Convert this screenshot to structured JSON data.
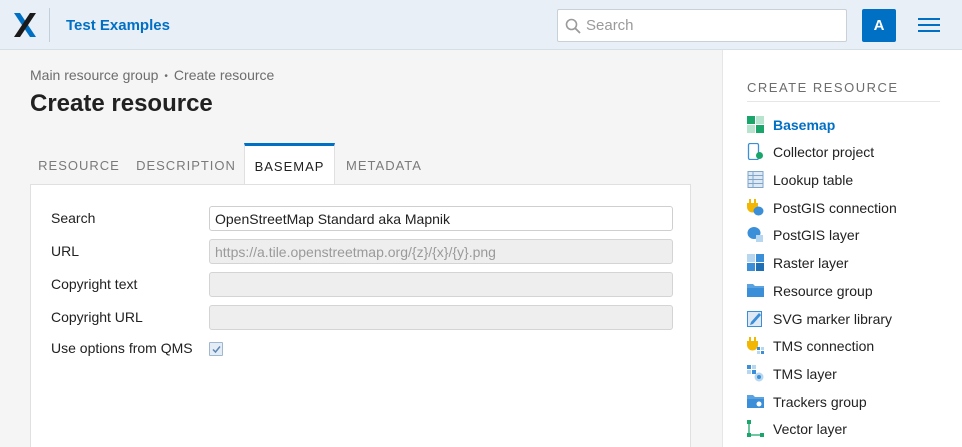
{
  "header": {
    "app_title": "Test Examples",
    "search_placeholder": "Search",
    "avatar_letter": "A",
    "menu_icon": "hamburger-menu-icon",
    "brand_color": "#0070c5"
  },
  "breadcrumb": {
    "items": [
      "Main resource group",
      "Create resource"
    ],
    "separator": "•"
  },
  "page_title": "Create resource",
  "tabs": [
    {
      "label": "RESOURCE",
      "active": false
    },
    {
      "label": "DESCRIPTION",
      "active": false
    },
    {
      "label": "BASEMAP",
      "active": true
    },
    {
      "label": "METADATA",
      "active": false
    }
  ],
  "form": {
    "search": {
      "label": "Search",
      "value": "OpenStreetMap Standard aka Mapnik"
    },
    "url": {
      "label": "URL",
      "value": "https://a.tile.openstreetmap.org/{z}/{x}/{y}.png",
      "disabled": true
    },
    "copyright_text": {
      "label": "Copyright text",
      "value": "",
      "disabled": true
    },
    "copyright_url": {
      "label": "Copyright URL",
      "value": "",
      "disabled": true
    },
    "use_qms": {
      "label": "Use options from QMS",
      "checked": true
    }
  },
  "sidebar": {
    "heading": "CREATE RESOURCE",
    "items": [
      {
        "label": "Basemap",
        "icon": "basemap-icon",
        "active": true
      },
      {
        "label": "Collector project",
        "icon": "collector-project-icon",
        "active": false
      },
      {
        "label": "Lookup table",
        "icon": "lookup-table-icon",
        "active": false
      },
      {
        "label": "PostGIS connection",
        "icon": "postgis-connection-icon",
        "active": false
      },
      {
        "label": "PostGIS layer",
        "icon": "postgis-layer-icon",
        "active": false
      },
      {
        "label": "Raster layer",
        "icon": "raster-layer-icon",
        "active": false
      },
      {
        "label": "Resource group",
        "icon": "folder-icon",
        "active": false
      },
      {
        "label": "SVG marker library",
        "icon": "svg-marker-library-icon",
        "active": false
      },
      {
        "label": "TMS connection",
        "icon": "tms-connection-icon",
        "active": false
      },
      {
        "label": "TMS layer",
        "icon": "tms-layer-icon",
        "active": false
      },
      {
        "label": "Trackers group",
        "icon": "trackers-group-icon",
        "active": false
      },
      {
        "label": "Vector layer",
        "icon": "vector-layer-icon",
        "active": false
      }
    ]
  }
}
